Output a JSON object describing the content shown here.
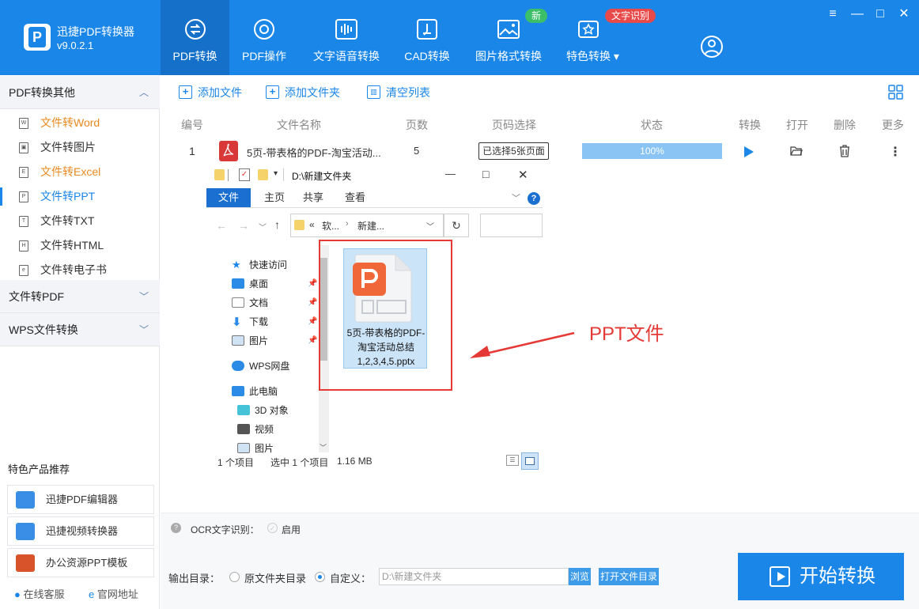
{
  "app": {
    "name": "迅捷PDF转换器",
    "version": "v9.0.2.1"
  },
  "nav": {
    "tabs": [
      {
        "label": "PDF转换",
        "icon": "pdf-convert-icon"
      },
      {
        "label": "PDF操作",
        "icon": "gear-icon"
      },
      {
        "label": "文字语音转换",
        "icon": "audio-wave-icon"
      },
      {
        "label": "CAD转换",
        "icon": "cad-icon"
      },
      {
        "label": "图片格式转换",
        "icon": "image-icon"
      },
      {
        "label": "特色转换",
        "icon": "star-convert-icon"
      }
    ],
    "badge_new": "新",
    "badge_ocr": "文字识别",
    "accent": "#1a86e8"
  },
  "sidebar": {
    "section1": "PDF转换其他",
    "items": [
      {
        "label": "文件转Word",
        "icon_text": "W"
      },
      {
        "label": "文件转图片",
        "icon_text": "▣"
      },
      {
        "label": "文件转Excel",
        "icon_text": "E"
      },
      {
        "label": "文件转PPT",
        "icon_text": "P"
      },
      {
        "label": "文件转TXT",
        "icon_text": "T"
      },
      {
        "label": "文件转HTML",
        "icon_text": "H"
      },
      {
        "label": "文件转电子书",
        "icon_text": "e"
      }
    ],
    "section2": "文件转PDF",
    "section3": "WPS文件转换",
    "products_title": "特色产品推荐",
    "products": [
      "迅捷PDF编辑器",
      "迅捷视频转换器",
      "办公资源PPT模板"
    ],
    "footer": {
      "service": "在线客服",
      "website": "官网地址"
    }
  },
  "toolbar": {
    "add_file": "添加文件",
    "add_folder": "添加文件夹",
    "clear": "清空列表"
  },
  "table": {
    "headers": {
      "no": "编号",
      "name": "文件名称",
      "pages": "页数",
      "page_select": "页码选择",
      "status": "状态",
      "convert": "转换",
      "open": "打开",
      "delete": "删除",
      "more": "更多"
    },
    "row": {
      "no": "1",
      "name": "5页-带表格的PDF-淘宝活动...",
      "pages": "5",
      "page_select": "已选择5张页面",
      "progress": "100%",
      "progress_value": 1.0
    }
  },
  "explorer": {
    "path_title": "D:\\新建文件夹",
    "ribbon_tabs": [
      "文件",
      "主页",
      "共享",
      "查看"
    ],
    "breadcrumb": {
      "prefix": "«",
      "part1": "软...",
      "part2": "新建..."
    },
    "tree": [
      {
        "label": "快速访问",
        "pinned": false
      },
      {
        "label": "桌面",
        "pinned": true
      },
      {
        "label": "文档",
        "pinned": true
      },
      {
        "label": "下载",
        "pinned": true
      },
      {
        "label": "图片",
        "pinned": true
      },
      {
        "label": "WPS网盘",
        "pinned": false
      },
      {
        "label": "此电脑",
        "pinned": false
      },
      {
        "label": "3D 对象",
        "pinned": false
      },
      {
        "label": "视频",
        "pinned": false
      },
      {
        "label": "图片",
        "pinned": false
      }
    ],
    "file_name": "5页-带表格的PDF-淘宝活动总结1,2,3,4,5.pptx",
    "status_items": "1 个项目",
    "status_selected": "选中 1 个项目",
    "status_size": "1.16 MB"
  },
  "annotation": "PPT文件",
  "bottom": {
    "ocr_label": "OCR文字识别：",
    "ocr_enable": "启用",
    "output_label": "输出目录：",
    "opt_source": "原文件夹目录",
    "opt_custom": "自定义：",
    "path": "D:\\新建文件夹",
    "browse": "浏览",
    "open_dir": "打开文件目录",
    "start": "开始转换"
  }
}
